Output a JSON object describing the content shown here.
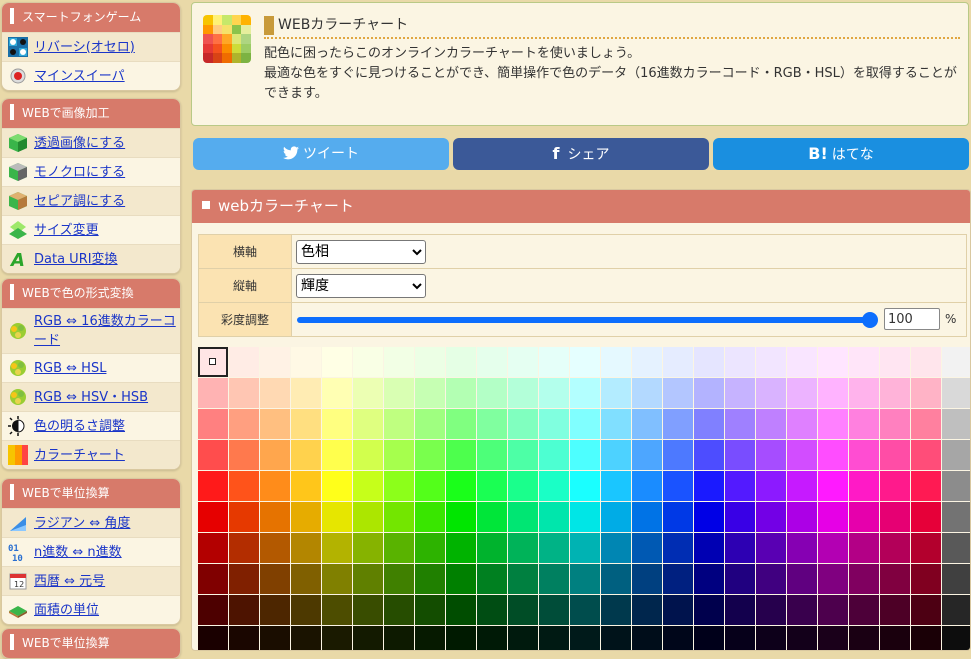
{
  "sidebar": [
    {
      "title": "スマートフォンゲーム",
      "items": [
        {
          "label": "リバーシ(オセロ)",
          "icon": "reversi-icon"
        },
        {
          "label": "マインスイーパ",
          "icon": "mine-icon"
        }
      ]
    },
    {
      "title": "WEBで画像加工",
      "items": [
        {
          "label": "透過画像にする",
          "icon": "green-cube-icon"
        },
        {
          "label": "モノクロにする",
          "icon": "mono-cube-icon"
        },
        {
          "label": "セピア調にする",
          "icon": "sepia-cube-icon"
        },
        {
          "label": "サイズ変更",
          "icon": "resize-icon"
        },
        {
          "label": "Data URI変換",
          "icon": "data-uri-icon"
        }
      ]
    },
    {
      "title": "WEBで色の形式変換",
      "items": [
        {
          "label": "RGB ⇔ 16進数カラーコード",
          "icon": "palette-icon"
        },
        {
          "label": "RGB ⇔ HSL",
          "icon": "palette-icon"
        },
        {
          "label": "RGB ⇔ HSV・HSB",
          "icon": "palette-icon"
        },
        {
          "label": "色の明るさ調整",
          "icon": "brightness-icon"
        },
        {
          "label": "カラーチャート",
          "icon": "color-chart-icon"
        }
      ]
    },
    {
      "title": "WEBで単位換算",
      "items": [
        {
          "label": "ラジアン ⇔ 角度",
          "icon": "angle-icon"
        },
        {
          "label": "n進数 ⇔ n進数",
          "icon": "binary-icon"
        },
        {
          "label": "西暦 ⇔ 元号",
          "icon": "calendar-icon"
        },
        {
          "label": "面積の単位",
          "icon": "area-icon"
        }
      ]
    },
    {
      "title": "WEBで単位換算",
      "items": []
    }
  ],
  "intro": {
    "title": "WEBカラーチャート",
    "text1": "配色に困ったらこのオンラインカラーチャートを使いましょう。",
    "text2": "最適な色をすぐに見つけることができ、簡単操作で色のデータ（16進数カラーコード・RGB・HSL）を取得することができます。"
  },
  "share": {
    "tweet": "ツイート",
    "tweet_color": "#55acee",
    "facebook": "シェア",
    "facebook_color": "#3b5998",
    "hatena": "はてな",
    "hatena_color": "#1a8fe0",
    "hatena_mark": "B!"
  },
  "panel": {
    "title": "webカラーチャート",
    "x_axis_label": "横軸",
    "x_axis_value": "色相",
    "y_axis_label": "縦軸",
    "y_axis_value": "輝度",
    "saturation_label": "彩度調整",
    "saturation_value": "100",
    "saturation_unit": "%"
  },
  "colors": {
    "accent": "#d77a6a",
    "link": "#1a35c8",
    "background": "#e9d9a8"
  },
  "color_chart": {
    "columns_hue": 24,
    "rows_lightness": [
      95,
      85,
      75,
      65,
      55,
      45,
      35,
      25,
      15,
      5,
      0
    ],
    "last_column": "gray"
  }
}
